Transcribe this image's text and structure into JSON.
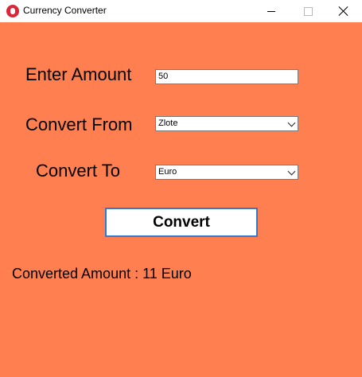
{
  "window": {
    "title": "Currency Converter"
  },
  "form": {
    "amount_label": "Enter Amount",
    "amount_value": "50",
    "from_label": "Convert From",
    "from_value": "Zlote",
    "to_label": "Convert To",
    "to_value": "Euro",
    "convert_label": "Convert"
  },
  "result": {
    "text": "Converted Amount : 11 Euro"
  },
  "colors": {
    "background": "#ff7f50",
    "button_border": "#2f7ad3"
  }
}
